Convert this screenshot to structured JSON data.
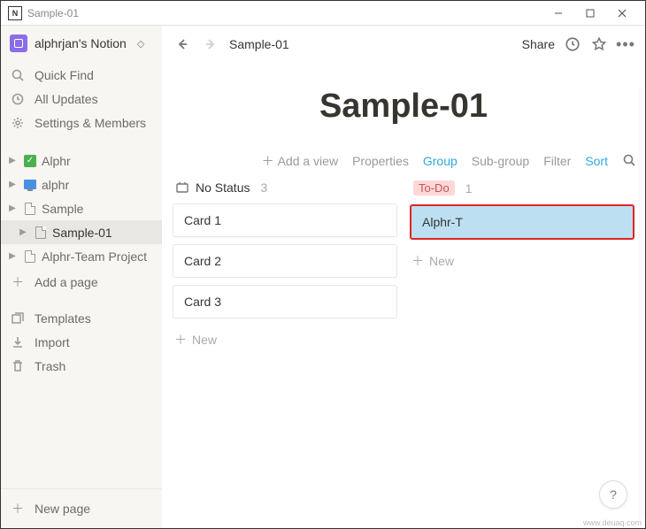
{
  "window": {
    "title": "Sample-01"
  },
  "workspace": {
    "name": "alphrjan's Notion"
  },
  "sidebar": {
    "quickFind": "Quick Find",
    "allUpdates": "All Updates",
    "settings": "Settings & Members",
    "pages": [
      {
        "label": "Alphr",
        "iconType": "check"
      },
      {
        "label": "alphr",
        "iconType": "monitor"
      },
      {
        "label": "Sample",
        "iconType": "doc"
      },
      {
        "label": "Sample-01",
        "iconType": "doc",
        "selected": true,
        "indent": true
      },
      {
        "label": "Alphr-Team Project",
        "iconType": "doc"
      }
    ],
    "addPage": "Add a page",
    "templates": "Templates",
    "import": "Import",
    "trash": "Trash",
    "newPage": "New page"
  },
  "topbar": {
    "breadcrumb": "Sample-01",
    "share": "Share"
  },
  "page": {
    "title": "Sample-01"
  },
  "views": {
    "addView": "Add a view",
    "properties": "Properties",
    "group": "Group",
    "subgroup": "Sub-group",
    "filter": "Filter",
    "sort": "Sort"
  },
  "board": {
    "columns": [
      {
        "name": "No Status",
        "count": "3",
        "style": "plain",
        "cards": [
          {
            "title": "Card 1"
          },
          {
            "title": "Card 2"
          },
          {
            "title": "Card 3"
          }
        ]
      },
      {
        "name": "To-Do",
        "count": "1",
        "style": "tag",
        "cards": [
          {
            "title": "Alphr-T",
            "highlight": true
          }
        ]
      }
    ],
    "newLabel": "New"
  },
  "help": "?",
  "watermark": "www.deuaq.com"
}
